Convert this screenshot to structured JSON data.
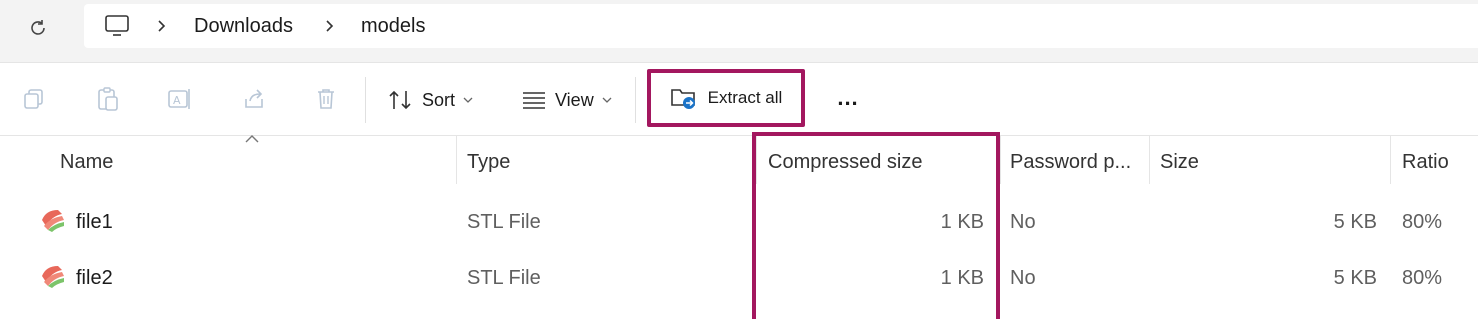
{
  "address_bar": {
    "icons": {
      "refresh": "refresh-icon",
      "this_pc": "monitor-icon"
    },
    "breadcrumb": [
      "Downloads",
      "models"
    ]
  },
  "toolbar": {
    "icons": [
      "copy-icon",
      "paste-icon",
      "rename-icon",
      "share-icon",
      "delete-icon"
    ],
    "sort_label": "Sort",
    "view_label": "View",
    "extract_label": "Extract all",
    "more_label": "...",
    "highlight_color": "#a3175f"
  },
  "columns": {
    "name": "Name",
    "type": "Type",
    "compressed_size": "Compressed size",
    "password": "Password p...",
    "size": "Size",
    "ratio": "Ratio"
  },
  "rows": [
    {
      "name": "file1",
      "type": "STL File",
      "compressed_size": "1 KB",
      "password": "No",
      "size": "5 KB",
      "ratio": "80%"
    },
    {
      "name": "file2",
      "type": "STL File",
      "compressed_size": "1 KB",
      "password": "No",
      "size": "5 KB",
      "ratio": "80%"
    }
  ]
}
